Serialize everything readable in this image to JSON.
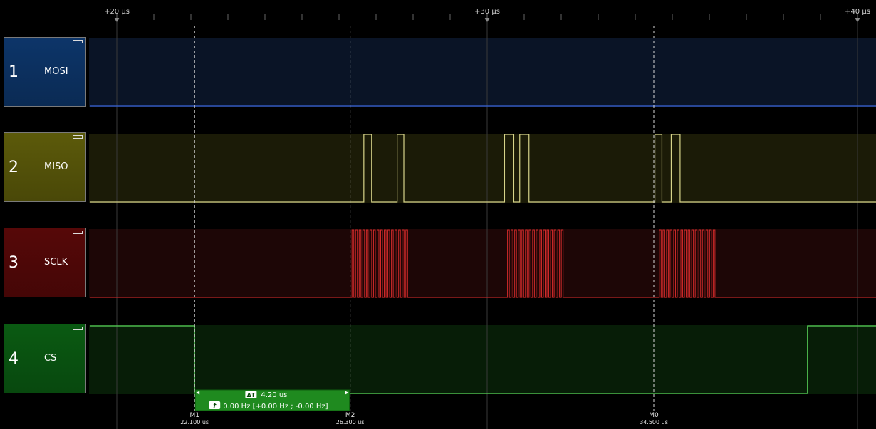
{
  "time_axis": {
    "ticks": [
      {
        "label": "+20 µs",
        "us": 20
      },
      {
        "label": "+30 µs",
        "us": 30
      },
      {
        "label": "+40 µs",
        "us": 40
      }
    ]
  },
  "channels": [
    {
      "number": "1",
      "name": "MOSI",
      "color": "#3a64d8",
      "box_color": "#0d3569",
      "band_color": "#0a1426"
    },
    {
      "number": "2",
      "name": "MISO",
      "color": "#d7d48a",
      "box_color": "#5c5a0a",
      "band_color": "#1b1b07"
    },
    {
      "number": "3",
      "name": "SCLK",
      "color": "#d22a2a",
      "box_color": "#560808",
      "band_color": "#1d0606"
    },
    {
      "number": "4",
      "name": "CS",
      "color": "#5ad55a",
      "box_color": "#0a5a12",
      "band_color": "#071d07"
    }
  ],
  "markers": [
    {
      "label": "M1",
      "time": "22.100 us",
      "us": 22.1
    },
    {
      "label": "M2",
      "time": "26.300 us",
      "us": 26.3
    },
    {
      "label": "M0",
      "time": "34.500 us",
      "us": 34.5
    }
  ],
  "measurement": {
    "delta_icon": "ΔT",
    "delta_value": "4.20 us",
    "freq_icon": "f",
    "freq_value": "0.00 Hz [+0.00 Hz ; -0.00 Hz]",
    "color": "#1f8a1f"
  },
  "waveforms": {
    "miso_pulses_us": [
      [
        26.67,
        26.88
      ],
      [
        27.57,
        27.75
      ],
      [
        30.47,
        30.72
      ],
      [
        30.88,
        31.13
      ],
      [
        34.53,
        34.72
      ],
      [
        34.97,
        35.21
      ]
    ],
    "sclk_bursts_us": [
      {
        "start": 26.35,
        "end": 27.9,
        "cycles": 16
      },
      {
        "start": 30.55,
        "end": 32.1,
        "cycles": 16
      },
      {
        "start": 34.65,
        "end": 36.2,
        "cycles": 16
      }
    ],
    "cs_low_us": [
      22.1,
      38.65
    ]
  }
}
